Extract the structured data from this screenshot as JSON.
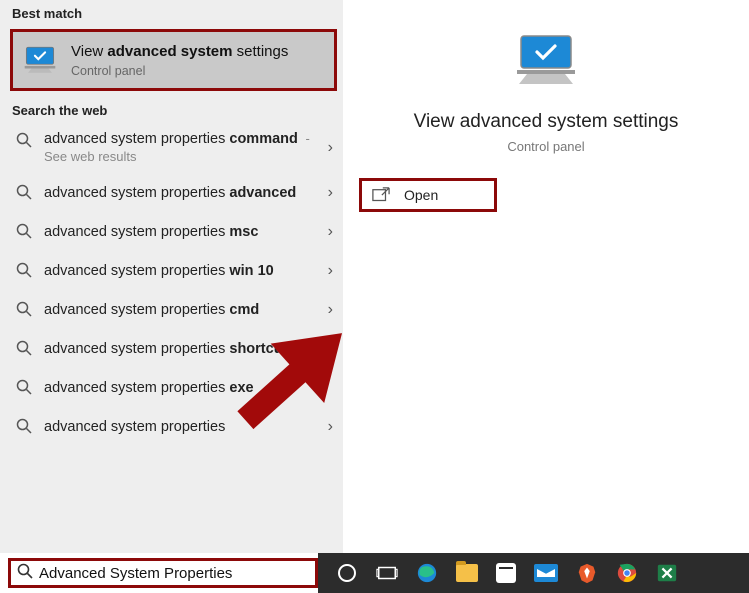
{
  "sections": {
    "best_match_label": "Best match",
    "search_web_label": "Search the web"
  },
  "best_match": {
    "title_pre": "View ",
    "title_bold": "advanced system",
    "title_post": " settings",
    "subtitle": "Control panel"
  },
  "web_results": [
    {
      "pre": "advanced system properties ",
      "bold": "command",
      "hint": " - See web results",
      "chevron": true
    },
    {
      "pre": "advanced system properties ",
      "bold": "advanced",
      "hint": "",
      "chevron": true
    },
    {
      "pre": "advanced system properties ",
      "bold": "msc",
      "hint": "",
      "chevron": true
    },
    {
      "pre": "advanced system properties ",
      "bold": "win 10",
      "hint": "",
      "chevron": true
    },
    {
      "pre": "advanced system properties ",
      "bold": "cmd",
      "hint": "",
      "chevron": true
    },
    {
      "pre": "advanced system properties ",
      "bold": "shortcut",
      "hint": "",
      "chevron": false
    },
    {
      "pre": "advanced system properties ",
      "bold": "exe",
      "hint": "",
      "chevron": false
    },
    {
      "pre": "advanced system properties",
      "bold": "",
      "hint": "",
      "chevron": true
    }
  ],
  "right": {
    "title": "View advanced system settings",
    "subtitle": "Control panel",
    "open_label": "Open"
  },
  "search": {
    "value": "Advanced System Properties"
  },
  "colors": {
    "highlight_border": "#8c0909",
    "accent_blue": "#1d89d6"
  }
}
